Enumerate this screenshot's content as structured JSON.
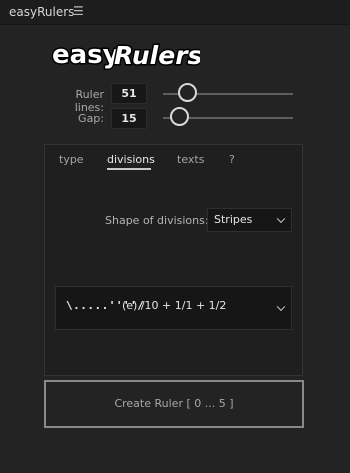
{
  "window": {
    "title": "easyRulers",
    "menu_icon": "hamburger-icon"
  },
  "logo": {
    "text_easy": "easy",
    "text_rulers": "Rulers"
  },
  "controls": {
    "ruler_lines": {
      "label": "Ruler lines:",
      "value": "51",
      "slider_fraction": 0.19
    },
    "gap": {
      "label": "Gap:",
      "value": "15",
      "slider_fraction": 0.13
    }
  },
  "tabs": [
    {
      "label": "type",
      "active": false
    },
    {
      "label": "divisions",
      "active": true
    },
    {
      "label": "texts",
      "active": false
    },
    {
      "label": "?",
      "active": false
    }
  ],
  "divisions": {
    "shape_label": "Shape of divisions:",
    "shape_value": "Stripes",
    "preset_glyph": "\\.....''''/",
    "preset_text": "(e)  /10 + 1/1 + 1/2"
  },
  "create_button": {
    "label": "Create Ruler [ 0 ... 5 ]"
  }
}
